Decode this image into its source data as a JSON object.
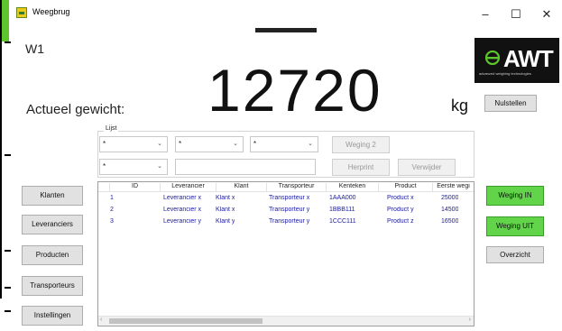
{
  "window": {
    "title": "Weegbrug",
    "controls": [
      "–",
      "☐",
      "✕"
    ]
  },
  "scale": {
    "id": "W1",
    "label": "Actueel gewicht:",
    "weight": "12720",
    "unit": "kg"
  },
  "logo": {
    "text": "AWT",
    "tagline": "advanced weighing technologies"
  },
  "buttons": {
    "reset": "Nulstellen",
    "weigh_in": "Weging IN",
    "weigh_out": "Weging UIT",
    "overview": "Overzicht",
    "weighing2": "Weging 2",
    "reprint": "Herprint",
    "remove": "Verwijder"
  },
  "nav": [
    "Klanten",
    "Leveranciers",
    "Producten",
    "Transporteurs",
    "Instellingen"
  ],
  "filter": {
    "legend": "Lijst",
    "combo1": "*",
    "combo2": "*",
    "combo3": "*",
    "combo4": "*"
  },
  "grid": {
    "columns": [
      "",
      "ID",
      "Leverancier",
      "Klant",
      "Transporteur",
      "Kenteken",
      "Product",
      "Eerste wegi"
    ],
    "rows": [
      [
        "1",
        "Leverancier x",
        "Klant x",
        "Transporteur x",
        "1AAA000",
        "Product x",
        "25000"
      ],
      [
        "2",
        "Leverancier x",
        "Klant x",
        "Transporteur y",
        "1BBB111",
        "Product y",
        "14500"
      ],
      [
        "3",
        "Leverancier y",
        "Klant y",
        "Transporteur y",
        "1CCC111",
        "Product z",
        "16500"
      ]
    ]
  },
  "colors": {
    "green_button": "#62d44a",
    "row_text": "#1a1aa0",
    "logo_bg": "#111111"
  }
}
